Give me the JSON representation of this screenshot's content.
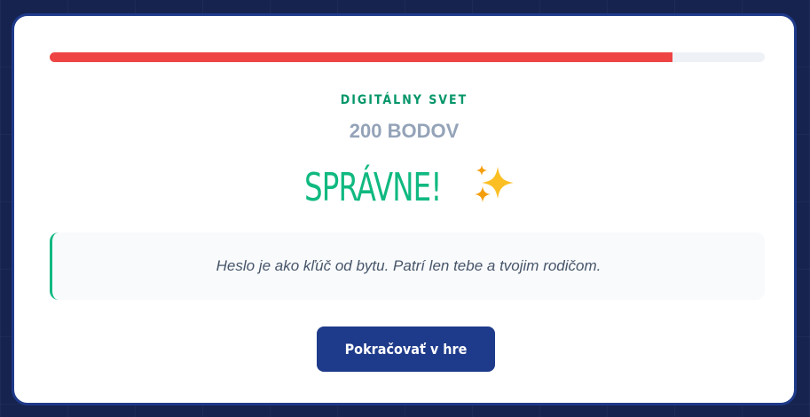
{
  "progress": {
    "fraction": 0.871,
    "fill_color": "#ef4444",
    "track_color": "#eef2f7"
  },
  "question": {
    "category": "DIGITÁLNY SVET",
    "points": "200 BODOV"
  },
  "result": {
    "title": "SPRÁVNE!",
    "icon": "sparkles-icon",
    "color": "#10b981"
  },
  "message": {
    "text": "Heslo je ako kľúč od bytu. Patrí len tebe a tvojim rodičom."
  },
  "actions": {
    "continue_label": "Pokračovať v hre"
  },
  "colors": {
    "accent": "#1e3a8a",
    "category": "#059669",
    "points": "#94a3b8"
  }
}
